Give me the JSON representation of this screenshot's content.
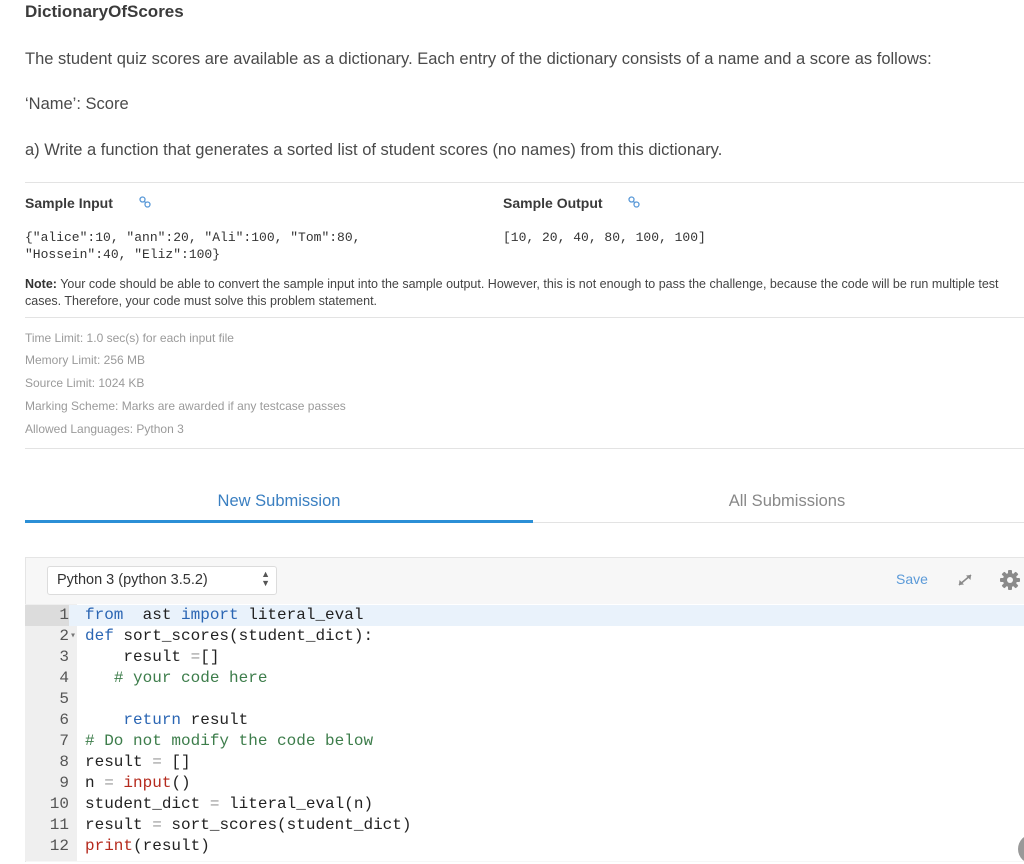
{
  "problem": {
    "title": "DictionaryOfScores",
    "intro": "The student quiz scores are available as a dictionary. Each entry of the dictionary consists of a name and a score as follows:",
    "format": "‘Name’: Score",
    "task": "a) Write a function that generates a sorted list of student scores (no names) from this dictionary."
  },
  "samples": {
    "input_label": "Sample Input",
    "output_label": "Sample Output",
    "input_line1": "{\"alice\":10, \"ann\":20, \"Ali\":100, \"Tom\":80,",
    "input_line2": "\"Hossein\":40, \"Eliz\":100}",
    "output": "[10, 20, 40, 80, 100, 100]",
    "link_icon": "link-icon"
  },
  "note": {
    "label": "Note:",
    "text": " Your code should be able to convert the sample input into the sample output. However, this is not enough to pass the challenge, because the code will be run multiple test cases. Therefore, your code must solve this problem statement."
  },
  "limits": [
    "Time Limit: 1.0 sec(s) for each input file",
    "Memory Limit: 256 MB",
    "Source Limit: 1024 KB",
    "Marking Scheme: Marks are awarded if any testcase passes",
    "Allowed Languages: Python 3"
  ],
  "tabs": {
    "new": "New Submission",
    "all": "All Submissions",
    "active": "new"
  },
  "editor": {
    "language": "Python 3 (python 3.5.2)",
    "save_label": "Save",
    "lines": [
      {
        "num": "1",
        "fold": "",
        "tokens": [
          [
            "kw",
            "from"
          ],
          [
            "",
            "  ast "
          ],
          [
            "kw",
            "import"
          ],
          [
            "",
            " literal_eval"
          ]
        ]
      },
      {
        "num": "2",
        "fold": "▾",
        "tokens": [
          [
            "kw",
            "def"
          ],
          [
            "",
            " sort_scores(student_dict):"
          ]
        ]
      },
      {
        "num": "3",
        "fold": "",
        "tokens": [
          [
            "",
            "    result "
          ],
          [
            "op",
            "="
          ],
          [
            "",
            "[]"
          ]
        ]
      },
      {
        "num": "4",
        "fold": "",
        "tokens": [
          [
            "",
            "   "
          ],
          [
            "cm",
            "# your code here"
          ]
        ]
      },
      {
        "num": "5",
        "fold": "",
        "tokens": []
      },
      {
        "num": "6",
        "fold": "",
        "tokens": [
          [
            "",
            "    "
          ],
          [
            "kw",
            "return"
          ],
          [
            "",
            " result"
          ]
        ]
      },
      {
        "num": "7",
        "fold": "",
        "tokens": [
          [
            "cm",
            "# Do not modify the code below"
          ]
        ]
      },
      {
        "num": "8",
        "fold": "",
        "tokens": [
          [
            "",
            "result "
          ],
          [
            "op",
            "="
          ],
          [
            "",
            " []"
          ]
        ]
      },
      {
        "num": "9",
        "fold": "",
        "tokens": [
          [
            "",
            "n "
          ],
          [
            "op",
            "="
          ],
          [
            "",
            " "
          ],
          [
            "bi",
            "input"
          ],
          [
            "",
            "()"
          ]
        ]
      },
      {
        "num": "10",
        "fold": "",
        "tokens": [
          [
            "",
            "student_dict "
          ],
          [
            "op",
            "="
          ],
          [
            "",
            " literal_eval(n)"
          ]
        ]
      },
      {
        "num": "11",
        "fold": "",
        "tokens": [
          [
            "",
            "result "
          ],
          [
            "op",
            "="
          ],
          [
            "",
            " sort_scores(student_dict)"
          ]
        ]
      },
      {
        "num": "12",
        "fold": "",
        "tokens": [
          [
            "bi",
            "print"
          ],
          [
            "",
            "(result)"
          ]
        ]
      }
    ]
  }
}
